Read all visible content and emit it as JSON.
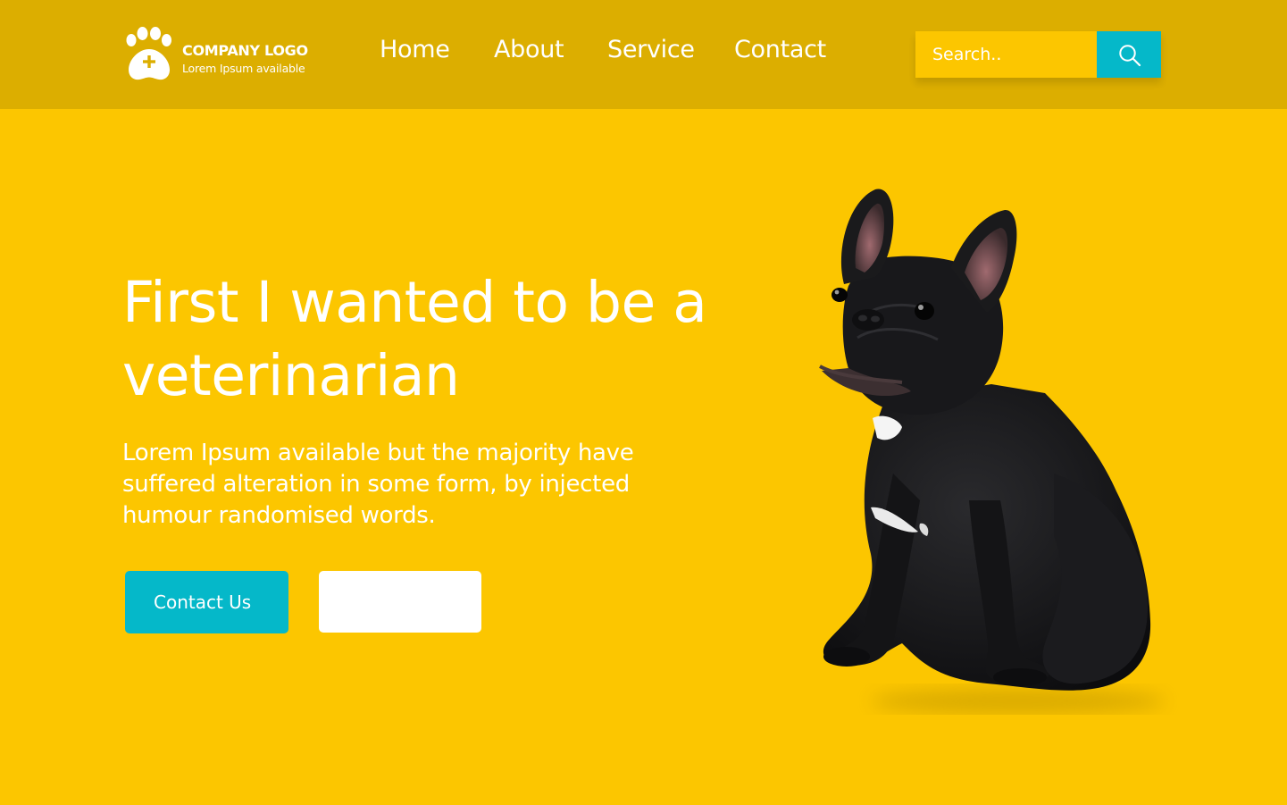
{
  "colors": {
    "page_background": "#FCC600",
    "header_background": "#DCAE00",
    "accent": "#05B8C9",
    "text": "#FFFFFF"
  },
  "header": {
    "logo": {
      "icon": "paw-plus-icon",
      "title": "COMPANY LOGO",
      "subtitle": "Lorem Ipsum available"
    },
    "nav": [
      {
        "label": "Home"
      },
      {
        "label": "About"
      },
      {
        "label": "Service"
      },
      {
        "label": "Contact"
      }
    ],
    "search": {
      "placeholder": "Search..",
      "value": "",
      "button_icon": "search-icon"
    }
  },
  "hero": {
    "title": "First I wanted to be a veterinarian",
    "text": "Lorem Ipsum available but the majority have suffered alteration in some form, by injected humour randomised words.",
    "primary_button": "Contact Us",
    "secondary_button": "",
    "image_icon": "french-bulldog-photo"
  }
}
